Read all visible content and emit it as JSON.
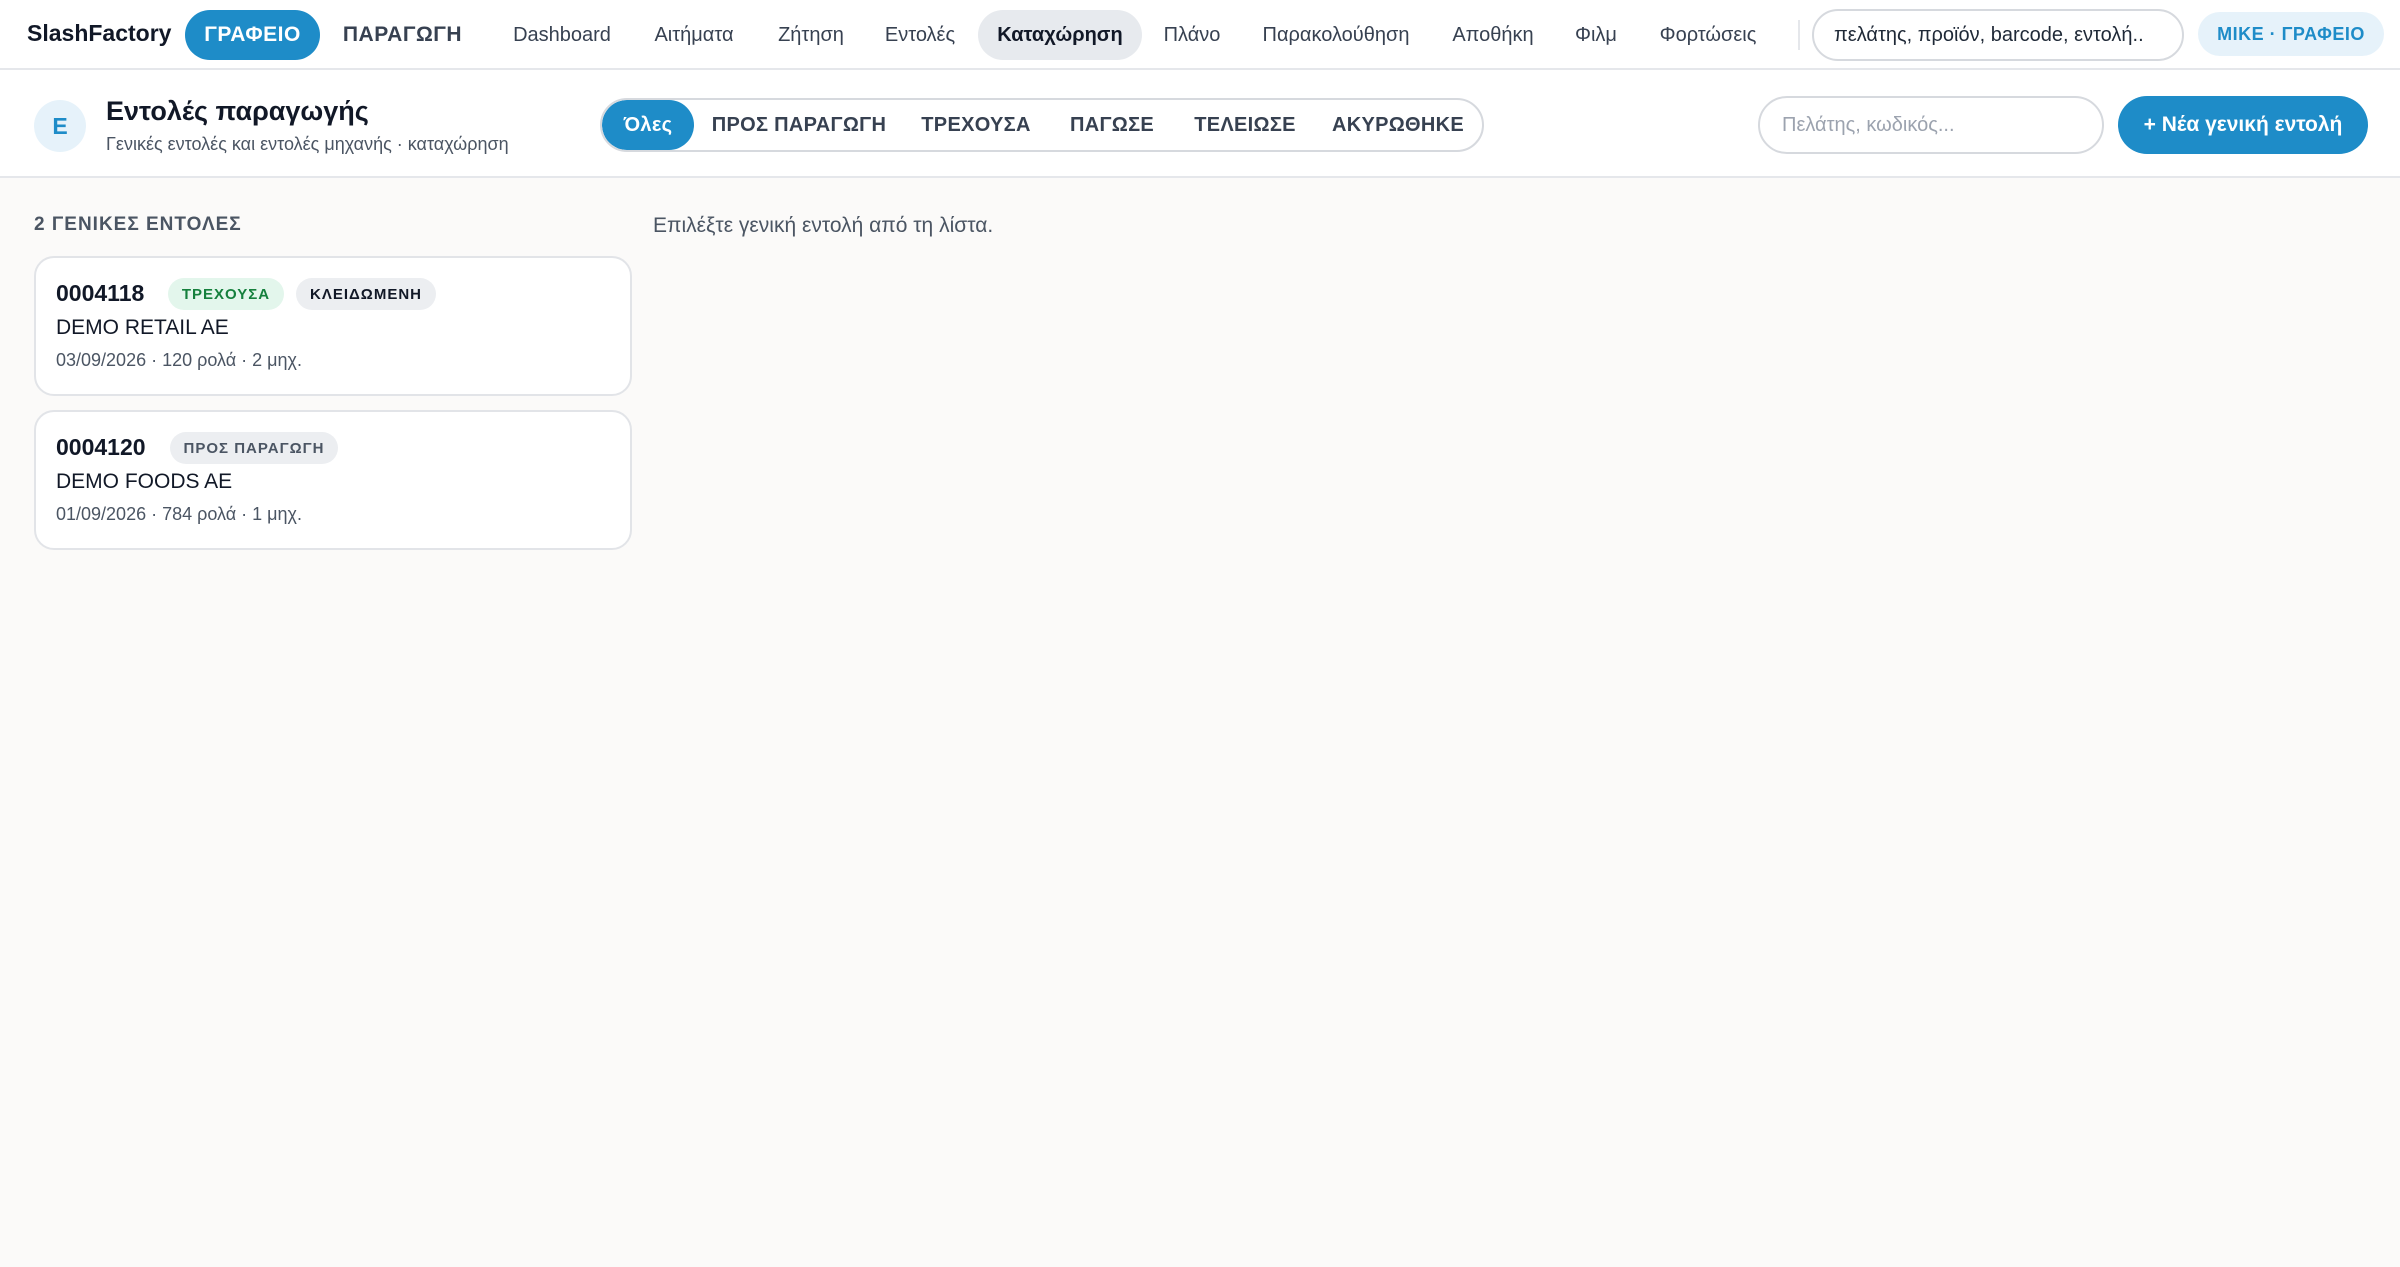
{
  "app": {
    "brand": "SlashFactory"
  },
  "modes": {
    "office": "ΓΡΑΦΕΙΟ",
    "production": "ΠΑΡΑΓΩΓΗ"
  },
  "nav": {
    "items": [
      "Dashboard",
      "Αιτήματα",
      "Ζήτηση",
      "Εντολές",
      "Καταχώρηση",
      "Πλάνο",
      "Παρακολούθηση",
      "Αποθήκη",
      "Φιλμ",
      "Φορτώσεις"
    ],
    "active": "Καταχώρηση"
  },
  "global_search": {
    "placeholder": "πελάτης, προϊόν, barcode, εντολή.."
  },
  "user": {
    "label": "MIKE · ΓΡΑΦΕΙΟ"
  },
  "header": {
    "avatar_letter": "E",
    "title": "Εντολές παραγωγής",
    "subtitle": "Γενικές εντολές και εντολές μηχανής · καταχώρηση"
  },
  "filters": {
    "items": [
      "Όλες",
      "ΠΡΟΣ ΠΑΡΑΓΩΓΗ",
      "ΤΡΕΧΟΥΣΑ",
      "ΠΑΓΩΣΕ",
      "ΤΕΛΕΙΩΣΕ",
      "ΑΚΥΡΩΘΗΚΕ"
    ],
    "active": "Όλες"
  },
  "order_search": {
    "placeholder": "Πελάτης, κωδικός..."
  },
  "new_order_button": "+ Νέα γενική εντολή",
  "list": {
    "heading": "2 ΓΕΝΙΚΕΣ ΕΝΤΟΛΕΣ",
    "orders": [
      {
        "code": "0004118",
        "badges": [
          "ΤΡΕΧΟΥΣΑ",
          "ΚΛΕΙΔΩΜΕΝΗ"
        ],
        "customer": "DEMO RETAIL AE",
        "meta": "03/09/2026 · 120 ρολά · 2 μηχ."
      },
      {
        "code": "0004120",
        "badges": [
          "ΠΡΟΣ ΠΑΡΑΓΩΓΗ"
        ],
        "customer": "DEMO FOODS AE",
        "meta": "01/09/2026 · 784 ρολά · 1 μηχ."
      }
    ]
  },
  "detail": {
    "empty_hint": "Επιλέξτε γενική εντολή από τη λίστα."
  },
  "colors": {
    "accent": "#1e8cc8",
    "running_badge_bg": "#e3f6ec",
    "running_badge_text": "#15803d",
    "neutral_badge_bg": "#eceef1"
  }
}
